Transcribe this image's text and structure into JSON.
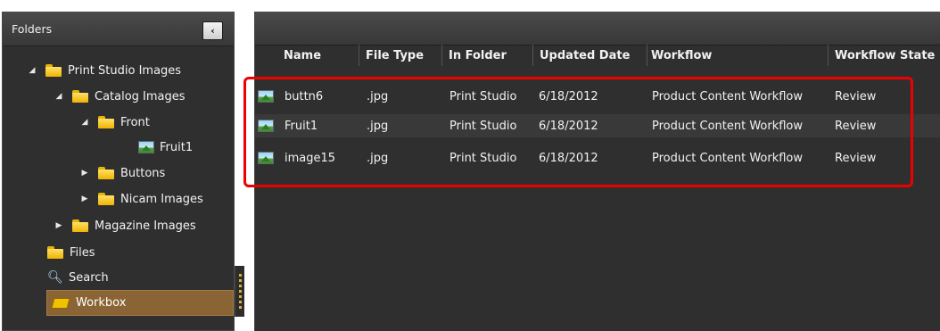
{
  "folders_panel": {
    "title": "Folders",
    "collapse_glyph": "‹",
    "tree": [
      {
        "label": "Print Studio Images",
        "icon": "folder-icon",
        "state": "expanded"
      },
      {
        "label": "Catalog Images",
        "icon": "folder-icon",
        "state": "expanded"
      },
      {
        "label": "Front",
        "icon": "folder-icon",
        "state": "expanded"
      },
      {
        "label": "Fruit1",
        "icon": "image-icon",
        "state": "leaf"
      },
      {
        "label": "Buttons",
        "icon": "folder-icon",
        "state": "collapsed"
      },
      {
        "label": "Nicam Images",
        "icon": "folder-icon",
        "state": "collapsed"
      },
      {
        "label": "Magazine Images",
        "icon": "folder-icon",
        "state": "collapsed"
      }
    ],
    "files_label": "Files",
    "search_label": "Search",
    "workbox_label": "Workbox",
    "selected_color": "#8a6434"
  },
  "table": {
    "columns": [
      "Name",
      "File Type",
      "In Folder",
      "Updated Date",
      "Workflow",
      "Workflow State"
    ],
    "rows": [
      {
        "name": "buttn6",
        "type": ".jpg",
        "folder": "Print Studio",
        "date": "6/18/2012",
        "workflow": "Product Content Workflow",
        "state": "Review"
      },
      {
        "name": "Fruit1",
        "type": ".jpg",
        "folder": "Print Studio",
        "date": "6/18/2012",
        "workflow": "Product Content Workflow",
        "state": "Review"
      },
      {
        "name": "image15",
        "type": ".jpg",
        "folder": "Print Studio",
        "date": "6/18/2012",
        "workflow": "Product Content Workflow",
        "state": "Review"
      }
    ]
  },
  "highlight_color": "#ee0000"
}
